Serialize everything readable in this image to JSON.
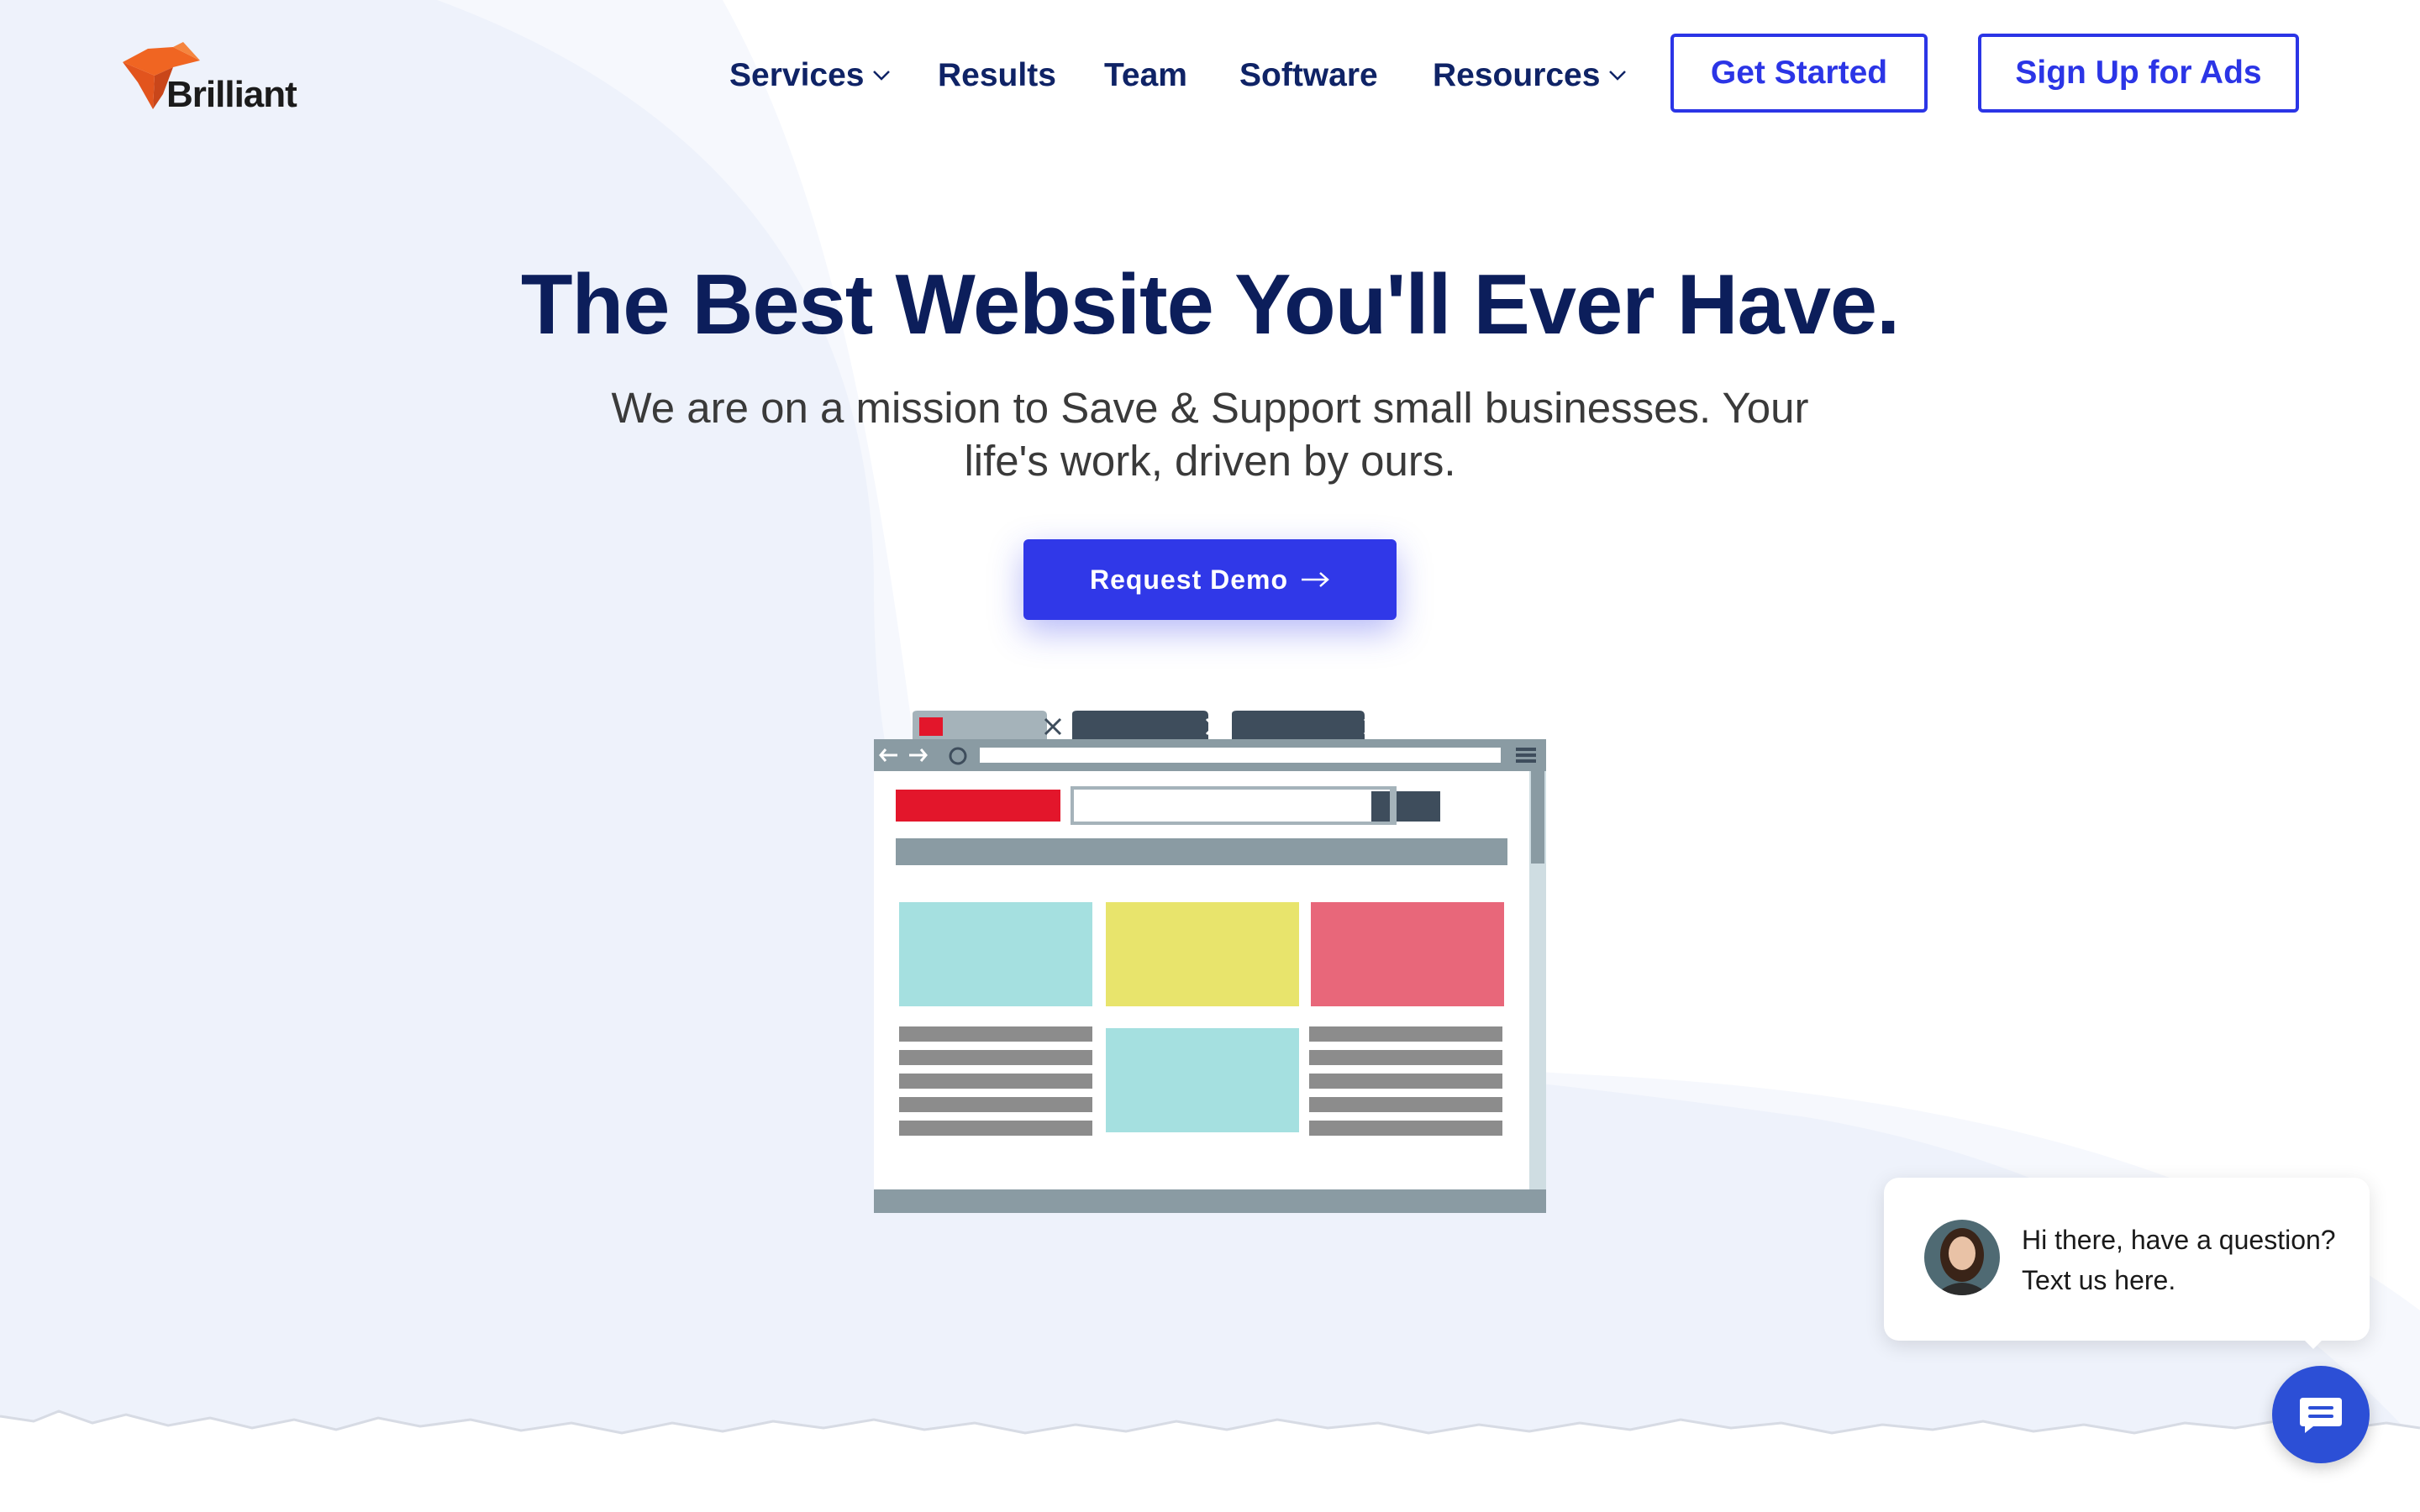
{
  "brand": {
    "name": "Brilliant",
    "accent": "#2b35e6",
    "navy": "#0f2366",
    "logo_orange": "#f06522"
  },
  "nav": {
    "items": [
      {
        "label": "Services",
        "has_dropdown": true
      },
      {
        "label": "Results",
        "has_dropdown": false
      },
      {
        "label": "Team",
        "has_dropdown": false
      },
      {
        "label": "Software",
        "has_dropdown": false
      },
      {
        "label": "Resources",
        "has_dropdown": true
      }
    ],
    "get_started": "Get Started",
    "sign_up_ads": "Sign Up for Ads"
  },
  "hero": {
    "title": "The Best Website You'll Ever Have.",
    "subtitle": "We are on a mission to Save & Support small businesses. Your life's work, driven by ours.",
    "cta": "Request Demo"
  },
  "chat": {
    "message": "Hi there, have a question? Text us here.",
    "icons": [
      "chat-icon"
    ]
  },
  "illustration": {
    "colors": {
      "red": "#e3162b",
      "teal": "#a5e0e0",
      "yellow": "#e8e46c",
      "pink": "#e8677a",
      "gray": "#8a9ba3",
      "dark": "#3e4d5c"
    }
  }
}
